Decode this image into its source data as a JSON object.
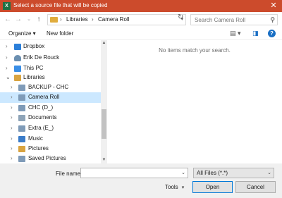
{
  "window": {
    "title": "Select a source file that will be copied",
    "app_icon": "excel-icon",
    "app_icon_letter": "X",
    "close_label": "✕",
    "accent": "#cc4b2c"
  },
  "address": {
    "breadcrumbs": [
      "Libraries",
      "Camera Roll"
    ],
    "separator": "›"
  },
  "search": {
    "placeholder": "Search Camera Roll"
  },
  "toolbar": {
    "organize": "Organize ▾",
    "new_folder": "New folder",
    "help": "?"
  },
  "nav_tree": [
    {
      "label": "Dropbox",
      "icon": "dropbox-icon",
      "color": "#2b7fd9"
    },
    {
      "label": "Erik De Rouck",
      "icon": "user-icon",
      "color": "#6b8fb0"
    },
    {
      "label": "This PC",
      "icon": "pc-icon",
      "color": "#3a8ee6"
    },
    {
      "label": "Libraries",
      "icon": "libraries-icon",
      "color": "#d9a441"
    },
    {
      "label": "BACKUP - CHC",
      "icon": "library-icon",
      "color": "#7f9bb8"
    },
    {
      "label": "Camera Roll",
      "icon": "library-icon",
      "color": "#7f9bb8"
    },
    {
      "label": "CHC (D_)",
      "icon": "library-icon",
      "color": "#7f9bb8"
    },
    {
      "label": "Documents",
      "icon": "documents-icon",
      "color": "#8ea4b8"
    },
    {
      "label": "Extra (E_)",
      "icon": "library-icon",
      "color": "#7f9bb8"
    },
    {
      "label": "Music",
      "icon": "music-icon",
      "color": "#3a7cc9"
    },
    {
      "label": "Pictures",
      "icon": "pictures-icon",
      "color": "#d9a441"
    },
    {
      "label": "Saved Pictures",
      "icon": "library-icon",
      "color": "#7f9bb8"
    }
  ],
  "content": {
    "empty_message": "No items match your search."
  },
  "bottom": {
    "file_name_label": "File name:",
    "file_name_value": "",
    "filter_value": "All Files (*.*)",
    "tools_label": "Tools",
    "open_label": "Open",
    "cancel_label": "Cancel"
  }
}
